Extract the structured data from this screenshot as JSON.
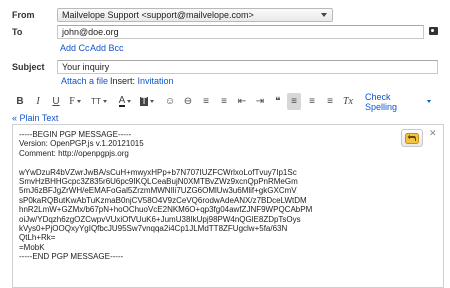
{
  "header": {
    "from_label": "From",
    "from_value": "Mailvelope Support <support@mailvelope.com>",
    "to_label": "To",
    "to_value": "john@doe.org",
    "add_cc": "Add Cc",
    "add_bcc": "Add Bcc",
    "subject_label": "Subject",
    "subject_value": "Your inquiry",
    "attach_file": "Attach a file",
    "insert_label": "Insert:",
    "invitation": "Invitation"
  },
  "toolbar": {
    "items": [
      {
        "name": "bold-button",
        "glyph": "B"
      },
      {
        "name": "italic-button",
        "glyph": "I"
      },
      {
        "name": "underline-button",
        "glyph": "U"
      },
      {
        "name": "font-family-button",
        "glyph": "F"
      },
      {
        "name": "font-size-button",
        "glyph": "TT"
      },
      {
        "name": "text-color-button",
        "glyph": "A"
      },
      {
        "name": "highlight-color-button",
        "glyph": "T"
      },
      {
        "name": "emoticon-button",
        "glyph": "☺"
      },
      {
        "name": "link-button",
        "glyph": "⊖"
      },
      {
        "name": "numbered-list-button",
        "glyph": "≡"
      },
      {
        "name": "bulleted-list-button",
        "glyph": "≡"
      },
      {
        "name": "indent-less-button",
        "glyph": "⇤"
      },
      {
        "name": "indent-more-button",
        "glyph": "⇥"
      },
      {
        "name": "quote-button",
        "glyph": "❝"
      },
      {
        "name": "align-left-button",
        "glyph": "≡"
      },
      {
        "name": "align-center-button",
        "glyph": "≡"
      },
      {
        "name": "align-right-button",
        "glyph": "≡"
      },
      {
        "name": "remove-formatting-button",
        "glyph": "Tx"
      }
    ],
    "check_spelling": "Check Spelling",
    "plain_text": "« Plain Text"
  },
  "message": {
    "pgp_lines": [
      "-----BEGIN PGP MESSAGE-----",
      "Version: OpenPGP.js v.1.20121015",
      "Comment: http://openpgpjs.org",
      "",
      "wYwDzuR4bVZwrJwBA/sCuH+mwyxHPp+b7N707IUZFCWrlxoLofTvuy7Ip1Sc",
      "SmvHzBHHGcpc3Z835r6U6pc9IKQLCeaBujN0XMTBvZWz9xcnQpPnRMeGm",
      "5mJ6zBFJgZrWH/eEMAFoGal5ZrzmMWNIli7UZG6OMlUw3u6Mlif+gkGXCmV",
      "sP0kaRQButKwAbTuKzmaB0njCV58O4V9zCeVQ6rodwAdeANX/z7BDceLWtDM",
      "hnR2LmW+GZMx/b67pN+hoOChuoVcE2NKM6O+qp3fg04awfZJNF9WPQCAbPM",
      "oiJw/YDqzh6zgOZCwpvVUxiOfVUuK6+JumU38IkUpj98PW4nQGlE8ZDpTsOys",
      "kVys0+PjOOQxyYgIQfbcJU95Sw7vnqqa2i4Cp1JLMdTT8ZFUgclw+5fa/63N",
      "QtLh+Rk=",
      "=MobK",
      "-----END PGP MESSAGE-----"
    ]
  },
  "colors": {
    "link": "#1155cc",
    "mailvelope_accent": "#e8a317"
  }
}
